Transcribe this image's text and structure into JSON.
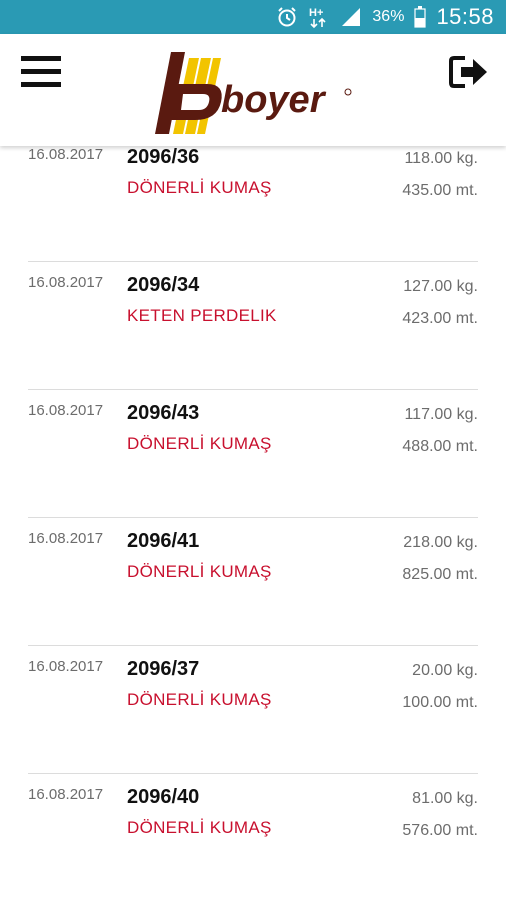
{
  "status_bar": {
    "battery": "36%",
    "time": "15:58",
    "network": "H+",
    "color": "#2a9ab4"
  },
  "header": {
    "logo_text": "boyer",
    "menu_icon": "hamburger-menu-icon",
    "logout_icon": "logout-icon"
  },
  "colors": {
    "accent_red": "#c8102e",
    "logo_dark": "#5a1a10",
    "logo_yellow": "#f2c400"
  },
  "items": [
    {
      "date": "16.08.2017",
      "code": "2096/36",
      "type": "DÖNERLİ KUMAŞ",
      "weight": "118.00 kg.",
      "length": "435.00 mt."
    },
    {
      "date": "16.08.2017",
      "code": "2096/34",
      "type": "KETEN PERDELIK",
      "weight": "127.00 kg.",
      "length": "423.00 mt."
    },
    {
      "date": "16.08.2017",
      "code": "2096/43",
      "type": "DÖNERLİ KUMAŞ",
      "weight": "117.00 kg.",
      "length": "488.00 mt."
    },
    {
      "date": "16.08.2017",
      "code": "2096/41",
      "type": "DÖNERLİ KUMAŞ",
      "weight": "218.00 kg.",
      "length": "825.00 mt."
    },
    {
      "date": "16.08.2017",
      "code": "2096/37",
      "type": "DÖNERLİ KUMAŞ",
      "weight": "20.00 kg.",
      "length": "100.00 mt."
    },
    {
      "date": "16.08.2017",
      "code": "2096/40",
      "type": "DÖNERLİ KUMAŞ",
      "weight": "81.00 kg.",
      "length": "576.00 mt."
    }
  ]
}
